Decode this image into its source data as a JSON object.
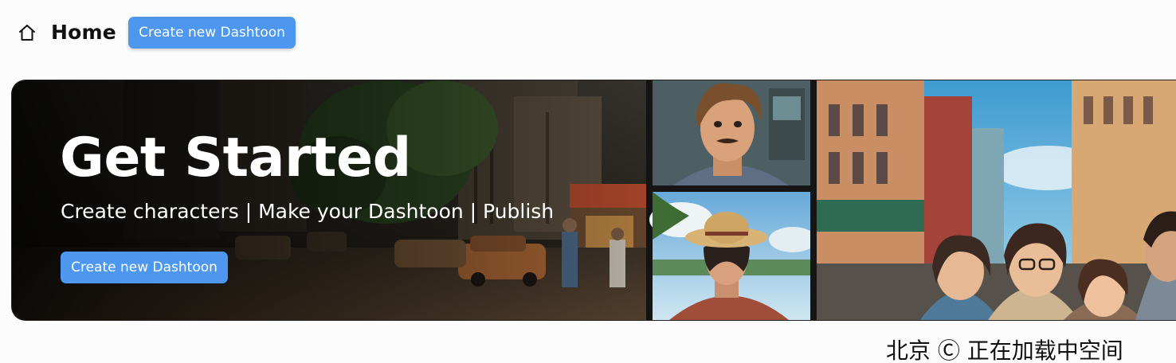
{
  "header": {
    "home_icon": "home-icon",
    "title": "Home",
    "create_button_label": "Create new Dashtoon"
  },
  "banner": {
    "heading": "Get Started",
    "subtitle": "Create characters | Make your Dashtoon | Publish",
    "button_label": "Create new Dashtoon",
    "images": [
      "city-street-illustration",
      "man-portrait-illustration",
      "boy-straw-hat-illustration",
      "friends-city-illustration"
    ]
  },
  "footer_partial_text": "北京 Ⓒ 正在加载中空间",
  "colors": {
    "accent": "#4d97ef",
    "background": "#fcfcfd",
    "text": "#111111"
  }
}
